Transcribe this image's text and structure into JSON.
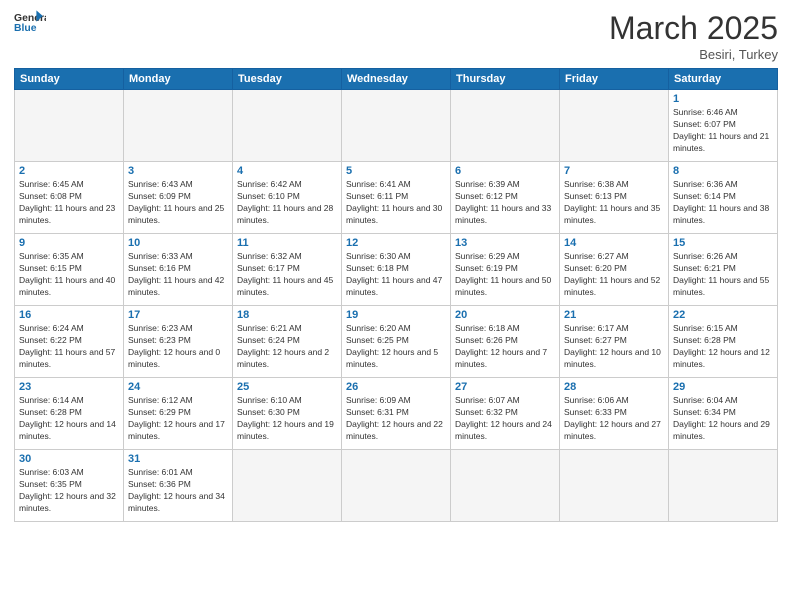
{
  "header": {
    "logo_general": "General",
    "logo_blue": "Blue",
    "month_title": "March 2025",
    "location": "Besiri, Turkey"
  },
  "weekdays": [
    "Sunday",
    "Monday",
    "Tuesday",
    "Wednesday",
    "Thursday",
    "Friday",
    "Saturday"
  ],
  "days": {
    "1": {
      "sunrise": "6:46 AM",
      "sunset": "6:07 PM",
      "daylight": "11 hours and 21 minutes."
    },
    "2": {
      "sunrise": "6:45 AM",
      "sunset": "6:08 PM",
      "daylight": "11 hours and 23 minutes."
    },
    "3": {
      "sunrise": "6:43 AM",
      "sunset": "6:09 PM",
      "daylight": "11 hours and 25 minutes."
    },
    "4": {
      "sunrise": "6:42 AM",
      "sunset": "6:10 PM",
      "daylight": "11 hours and 28 minutes."
    },
    "5": {
      "sunrise": "6:41 AM",
      "sunset": "6:11 PM",
      "daylight": "11 hours and 30 minutes."
    },
    "6": {
      "sunrise": "6:39 AM",
      "sunset": "6:12 PM",
      "daylight": "11 hours and 33 minutes."
    },
    "7": {
      "sunrise": "6:38 AM",
      "sunset": "6:13 PM",
      "daylight": "11 hours and 35 minutes."
    },
    "8": {
      "sunrise": "6:36 AM",
      "sunset": "6:14 PM",
      "daylight": "11 hours and 38 minutes."
    },
    "9": {
      "sunrise": "6:35 AM",
      "sunset": "6:15 PM",
      "daylight": "11 hours and 40 minutes."
    },
    "10": {
      "sunrise": "6:33 AM",
      "sunset": "6:16 PM",
      "daylight": "11 hours and 42 minutes."
    },
    "11": {
      "sunrise": "6:32 AM",
      "sunset": "6:17 PM",
      "daylight": "11 hours and 45 minutes."
    },
    "12": {
      "sunrise": "6:30 AM",
      "sunset": "6:18 PM",
      "daylight": "11 hours and 47 minutes."
    },
    "13": {
      "sunrise": "6:29 AM",
      "sunset": "6:19 PM",
      "daylight": "11 hours and 50 minutes."
    },
    "14": {
      "sunrise": "6:27 AM",
      "sunset": "6:20 PM",
      "daylight": "11 hours and 52 minutes."
    },
    "15": {
      "sunrise": "6:26 AM",
      "sunset": "6:21 PM",
      "daylight": "11 hours and 55 minutes."
    },
    "16": {
      "sunrise": "6:24 AM",
      "sunset": "6:22 PM",
      "daylight": "11 hours and 57 minutes."
    },
    "17": {
      "sunrise": "6:23 AM",
      "sunset": "6:23 PM",
      "daylight": "12 hours and 0 minutes."
    },
    "18": {
      "sunrise": "6:21 AM",
      "sunset": "6:24 PM",
      "daylight": "12 hours and 2 minutes."
    },
    "19": {
      "sunrise": "6:20 AM",
      "sunset": "6:25 PM",
      "daylight": "12 hours and 5 minutes."
    },
    "20": {
      "sunrise": "6:18 AM",
      "sunset": "6:26 PM",
      "daylight": "12 hours and 7 minutes."
    },
    "21": {
      "sunrise": "6:17 AM",
      "sunset": "6:27 PM",
      "daylight": "12 hours and 10 minutes."
    },
    "22": {
      "sunrise": "6:15 AM",
      "sunset": "6:28 PM",
      "daylight": "12 hours and 12 minutes."
    },
    "23": {
      "sunrise": "6:14 AM",
      "sunset": "6:28 PM",
      "daylight": "12 hours and 14 minutes."
    },
    "24": {
      "sunrise": "6:12 AM",
      "sunset": "6:29 PM",
      "daylight": "12 hours and 17 minutes."
    },
    "25": {
      "sunrise": "6:10 AM",
      "sunset": "6:30 PM",
      "daylight": "12 hours and 19 minutes."
    },
    "26": {
      "sunrise": "6:09 AM",
      "sunset": "6:31 PM",
      "daylight": "12 hours and 22 minutes."
    },
    "27": {
      "sunrise": "6:07 AM",
      "sunset": "6:32 PM",
      "daylight": "12 hours and 24 minutes."
    },
    "28": {
      "sunrise": "6:06 AM",
      "sunset": "6:33 PM",
      "daylight": "12 hours and 27 minutes."
    },
    "29": {
      "sunrise": "6:04 AM",
      "sunset": "6:34 PM",
      "daylight": "12 hours and 29 minutes."
    },
    "30": {
      "sunrise": "6:03 AM",
      "sunset": "6:35 PM",
      "daylight": "12 hours and 32 minutes."
    },
    "31": {
      "sunrise": "6:01 AM",
      "sunset": "6:36 PM",
      "daylight": "12 hours and 34 minutes."
    }
  }
}
